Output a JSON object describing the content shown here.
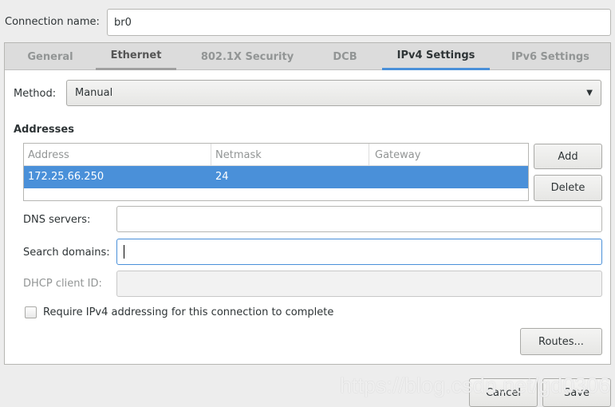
{
  "connection_name": {
    "label": "Connection name:",
    "value": "br0"
  },
  "tabs": [
    {
      "label": "General"
    },
    {
      "label": "Ethernet"
    },
    {
      "label": "802.1X Security"
    },
    {
      "label": "DCB"
    },
    {
      "label": "IPv4 Settings",
      "active": true
    },
    {
      "label": "IPv6 Settings"
    }
  ],
  "method": {
    "label": "Method:",
    "value": "Manual"
  },
  "addresses": {
    "heading": "Addresses",
    "columns": [
      "Address",
      "Netmask",
      "Gateway"
    ],
    "rows": [
      {
        "address": "172.25.66.250",
        "netmask": "24",
        "gateway": ""
      }
    ],
    "add": "Add",
    "delete": "Delete"
  },
  "dns": {
    "label": "DNS servers:",
    "value": ""
  },
  "search": {
    "label": "Search domains:",
    "value": ""
  },
  "dhcp": {
    "label": "DHCP client ID:",
    "value": ""
  },
  "require": {
    "label": "Require IPv4 addressing for this connection to complete",
    "checked": false
  },
  "routes": "Routes...",
  "cancel": "Cancel",
  "save": "Save",
  "watermark": "https://blog.csdn.net/gd0306",
  "colors": {
    "accent": "#4a90d9"
  }
}
